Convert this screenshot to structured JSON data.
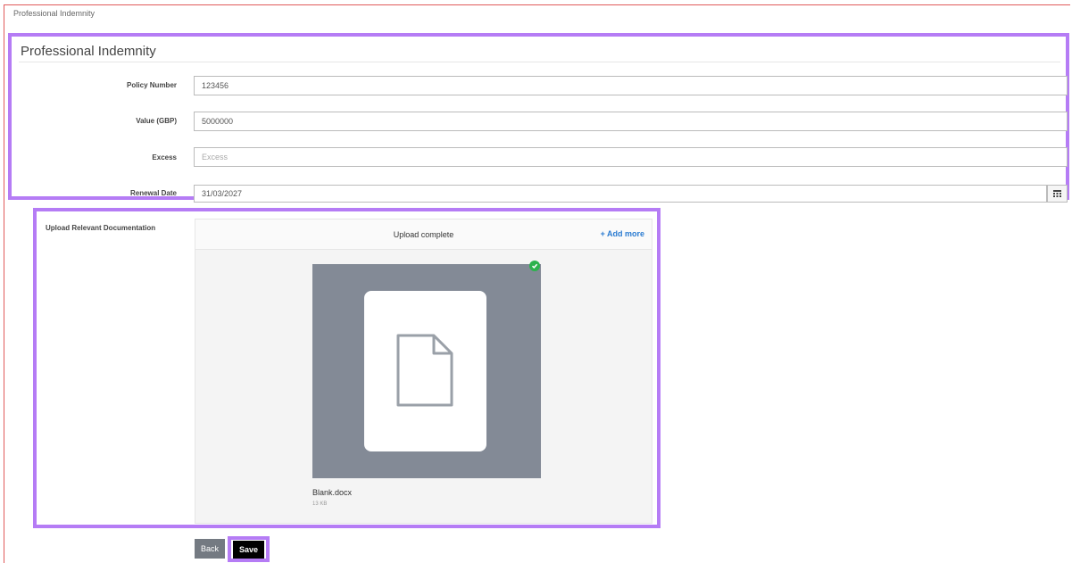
{
  "breadcrumb": "Professional Indemnity",
  "section": {
    "title": "Professional Indemnity",
    "fields": {
      "policy_number": {
        "label": "Policy Number",
        "value": "123456"
      },
      "value_gbp": {
        "label": "Value (GBP)",
        "value": "5000000"
      },
      "excess": {
        "label": "Excess",
        "value": "",
        "placeholder": "Excess"
      },
      "renewal_date": {
        "label": "Renewal Date",
        "value": "31/03/2027"
      }
    }
  },
  "upload": {
    "label": "Upload Relevant Documentation",
    "status": "Upload complete",
    "add_more": "+ Add more",
    "file": {
      "name": "Blank.docx",
      "size": "13 KB"
    }
  },
  "actions": {
    "back_label": "Back",
    "save_label": "Save"
  },
  "colors": {
    "highlight": "#b57cf5",
    "thumb_bg": "#838a96",
    "success": "#2bb24c",
    "link": "#2a7bd1",
    "frame": "#e05a5a"
  },
  "icons": {
    "calendar": "calendar-icon",
    "document": "document-icon",
    "check": "check-circle-icon"
  }
}
